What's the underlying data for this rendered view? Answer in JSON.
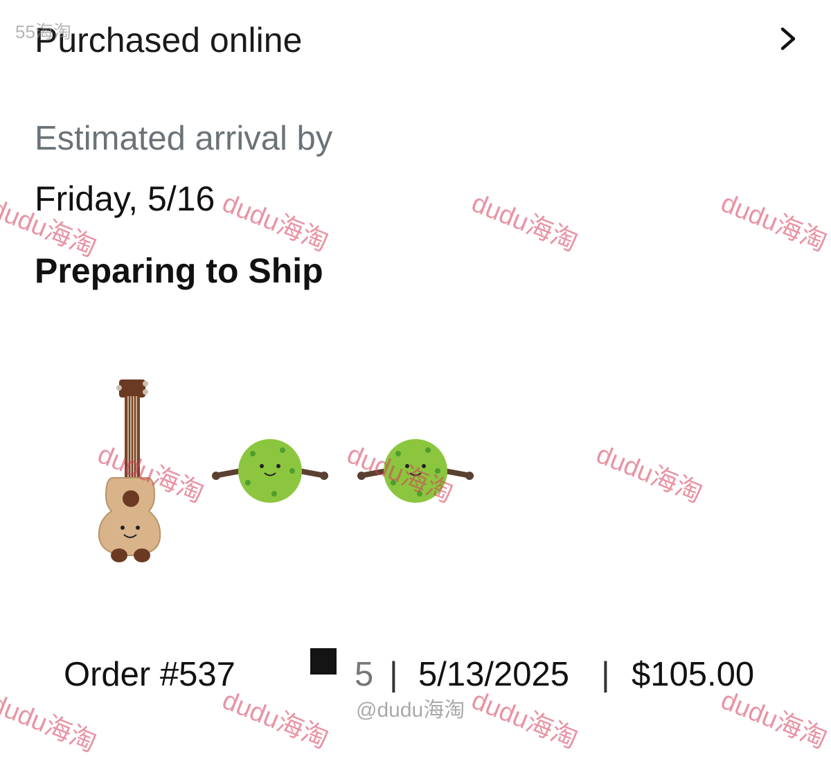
{
  "header": {
    "title": "Purchased online",
    "chevron_icon": "chevron-right-icon"
  },
  "delivery": {
    "eta_label": "Estimated arrival by",
    "eta_date": "Friday, 5/16",
    "status": "Preparing to Ship"
  },
  "items": [
    {
      "name": "ukulele-plush",
      "icon": "ukulele-plush-image"
    },
    {
      "name": "pickleball-plush-1",
      "icon": "green-ball-plush-image"
    },
    {
      "name": "pickleball-plush-2",
      "icon": "green-ball-plush-image"
    }
  ],
  "order": {
    "prefix": "Order #537",
    "suffix": "5",
    "separator": "|",
    "date": "5/13/2025",
    "total": "$105.00"
  },
  "watermarks": {
    "corner": "55海淘",
    "repeat": "dudu海淘",
    "credit": "@dudu海淘"
  },
  "colors": {
    "text": "#111111",
    "muted": "#6b7378",
    "watermark": "#d63c5a",
    "plush_green": "#8cc63f",
    "plush_tan": "#d9b48a"
  }
}
